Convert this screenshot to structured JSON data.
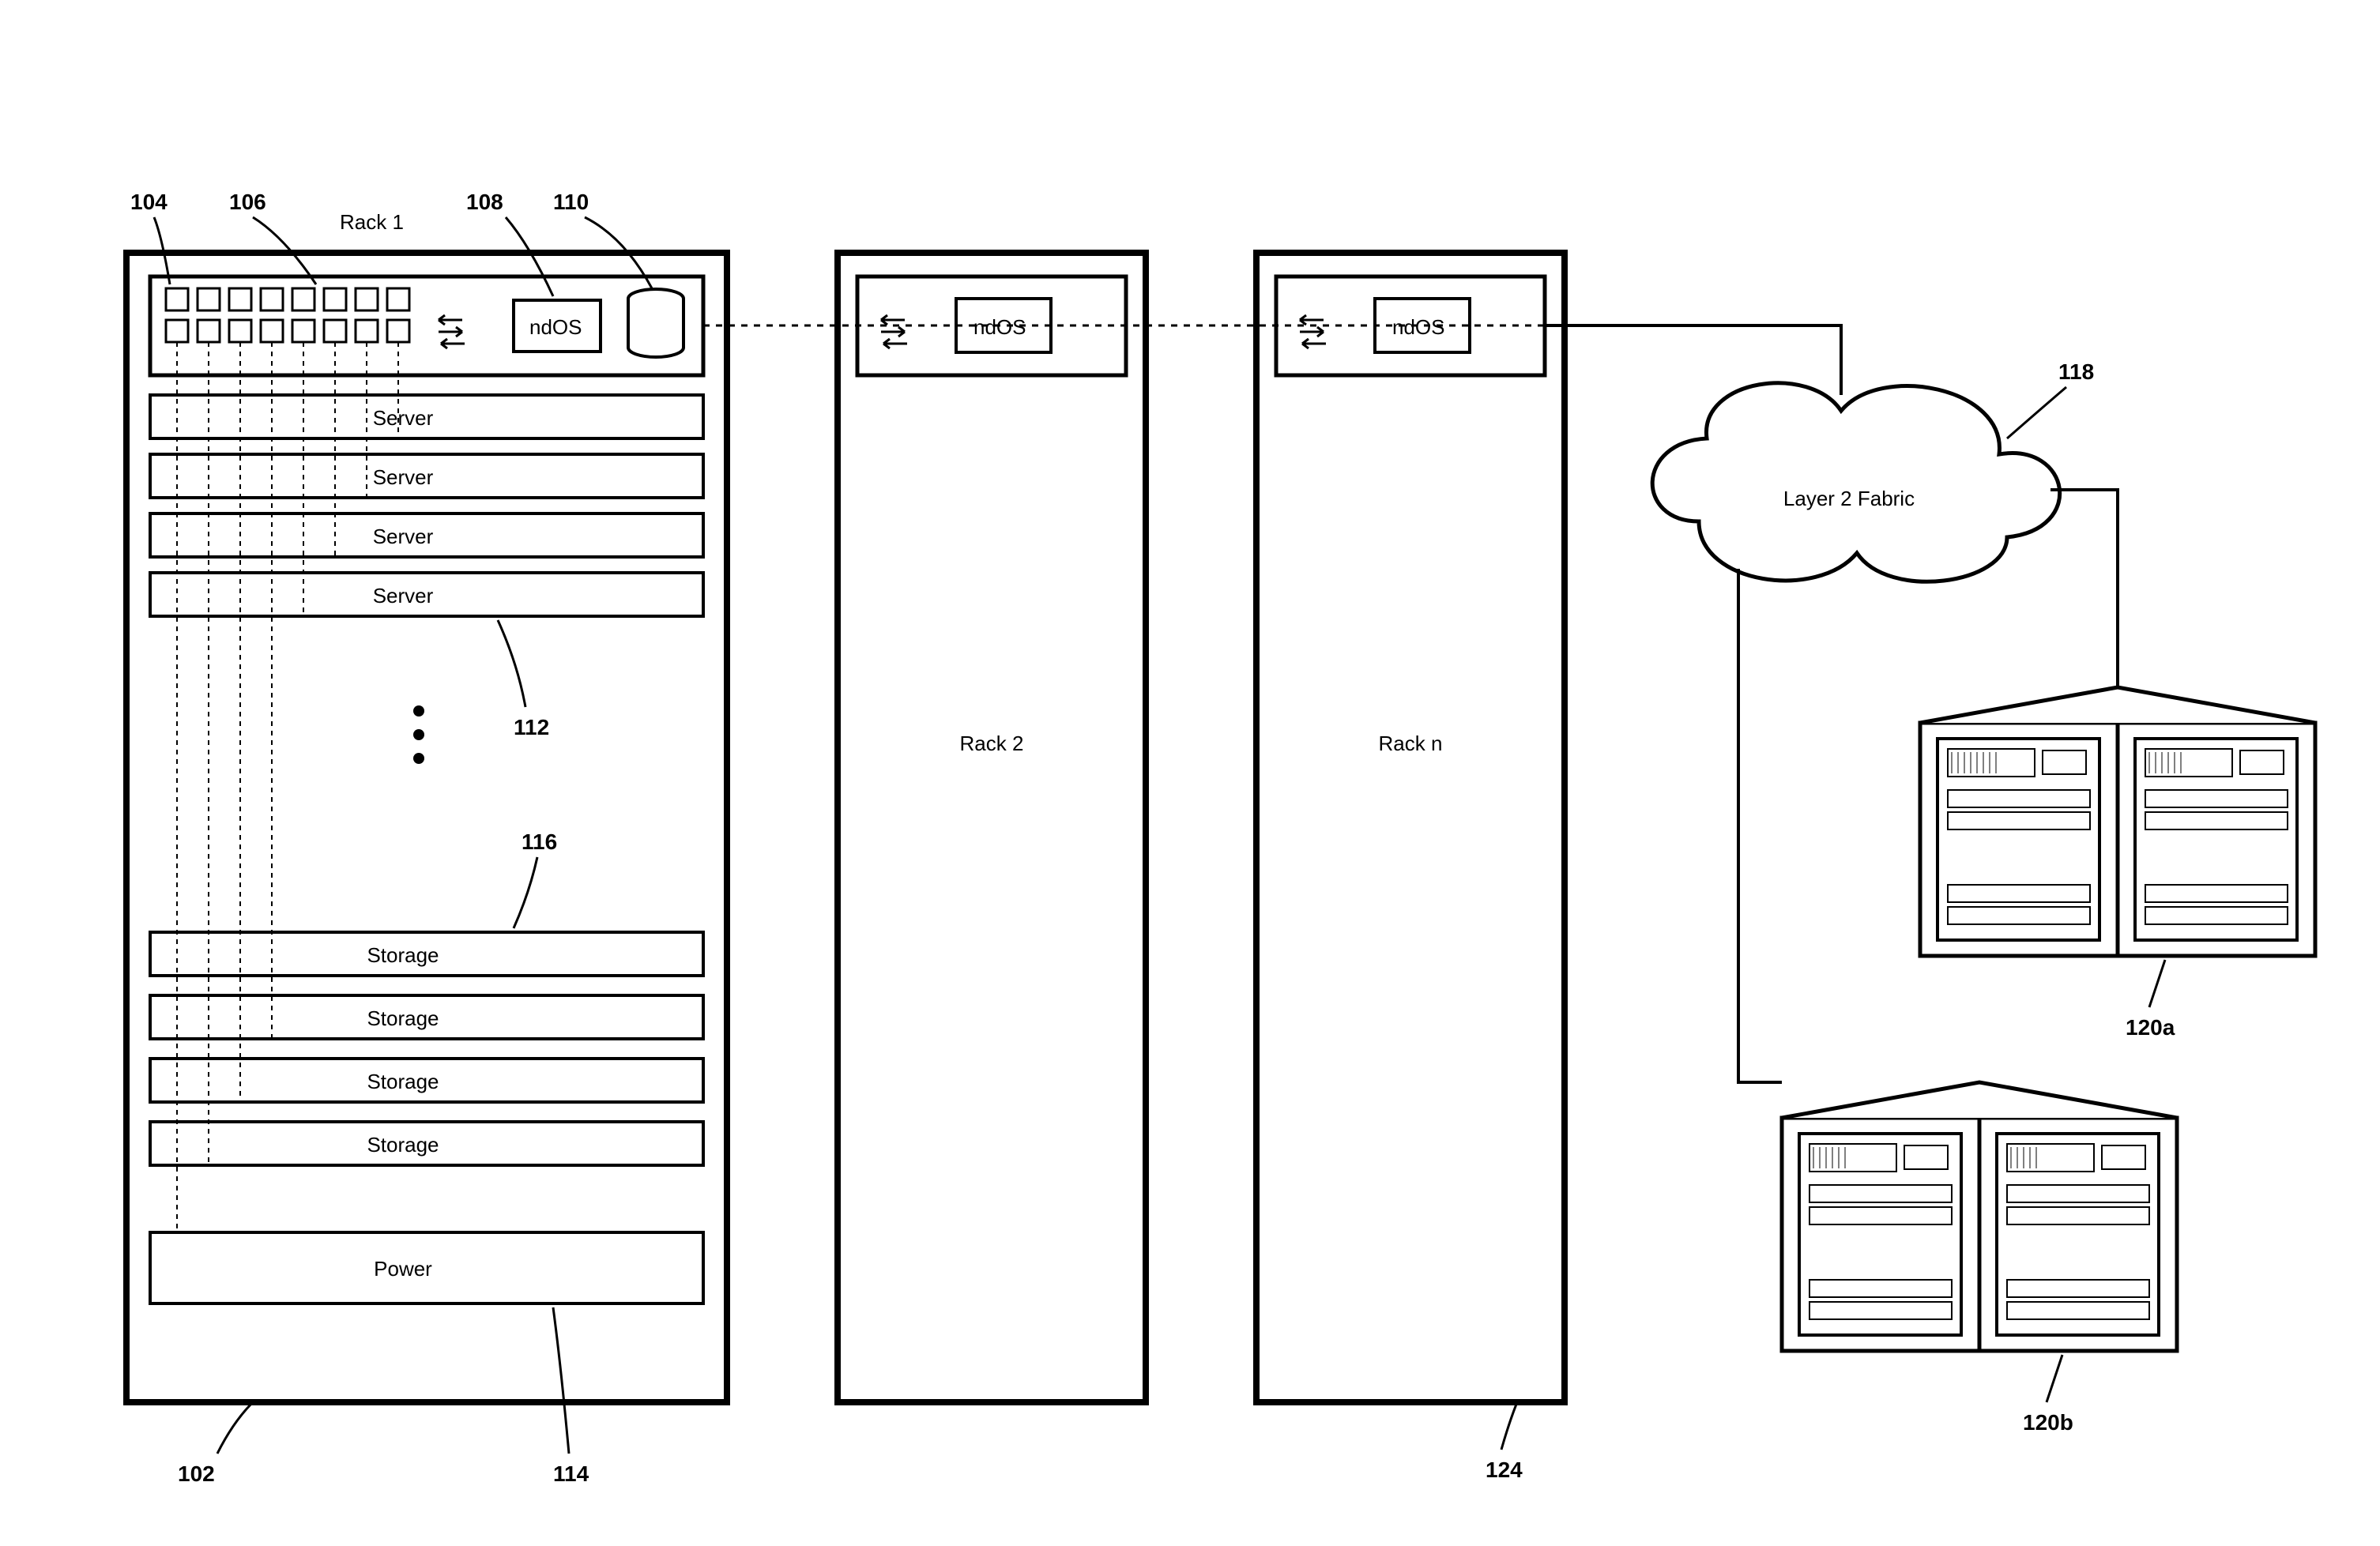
{
  "refs": {
    "r104": "104",
    "r106": "106",
    "r108": "108",
    "r110": "110",
    "r102": "102",
    "r112": "112",
    "r114": "114",
    "r116": "116",
    "r118": "118",
    "r120a": "120a",
    "r120b": "120b",
    "r124": "124"
  },
  "rack1": {
    "title": "Rack 1",
    "ndos": "ndOS",
    "servers": [
      "Server",
      "Server",
      "Server",
      "Server"
    ],
    "storages": [
      "Storage",
      "Storage",
      "Storage",
      "Storage"
    ],
    "power": "Power"
  },
  "rack2": {
    "title": "Rack 2",
    "ndos": "ndOS"
  },
  "rackn": {
    "title": "Rack n",
    "ndos": "ndOS"
  },
  "fabric": "Layer 2 Fabric"
}
